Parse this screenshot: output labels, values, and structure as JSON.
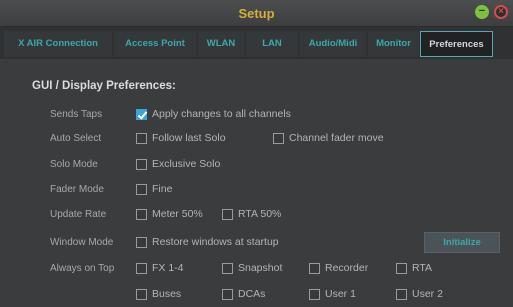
{
  "window": {
    "title": "Setup"
  },
  "tabs": [
    {
      "label": "X AIR Connection"
    },
    {
      "label": "Access Point"
    },
    {
      "label": "WLAN"
    },
    {
      "label": "LAN"
    },
    {
      "label": "Audio/Midi"
    },
    {
      "label": "Monitor"
    },
    {
      "label": "Preferences",
      "active": true
    }
  ],
  "section": {
    "title": "GUI / Display Preferences:"
  },
  "rows": {
    "sends_taps": {
      "label": "Sends Taps"
    },
    "auto_select": {
      "label": "Auto Select"
    },
    "solo_mode": {
      "label": "Solo Mode"
    },
    "fader_mode": {
      "label": "Fader Mode"
    },
    "update_rate": {
      "label": "Update Rate"
    },
    "window_mode": {
      "label": "Window Mode"
    },
    "always_on_top": {
      "label": "Always on Top"
    }
  },
  "options": {
    "apply_all_channels": {
      "label": "Apply changes to all channels",
      "checked": true
    },
    "follow_last_solo": {
      "label": "Follow last Solo",
      "checked": false
    },
    "channel_fader_move": {
      "label": "Channel fader move",
      "checked": false
    },
    "exclusive_solo": {
      "label": "Exclusive Solo",
      "checked": false
    },
    "fine": {
      "label": "Fine",
      "checked": false
    },
    "meter_50": {
      "label": "Meter 50%",
      "checked": false
    },
    "rta_50": {
      "label": "RTA 50%",
      "checked": false
    },
    "restore_windows": {
      "label": "Restore windows at startup",
      "checked": false
    },
    "fx_1_4": {
      "label": "FX 1-4",
      "checked": false
    },
    "snapshot": {
      "label": "Snapshot",
      "checked": false
    },
    "recorder": {
      "label": "Recorder",
      "checked": false
    },
    "rta": {
      "label": "RTA",
      "checked": false
    },
    "buses": {
      "label": "Buses",
      "checked": false
    },
    "dcas": {
      "label": "DCAs",
      "checked": false
    },
    "user_1": {
      "label": "User 1",
      "checked": false
    },
    "user_2": {
      "label": "User 2",
      "checked": false
    }
  },
  "buttons": {
    "initialize": "Initialize"
  },
  "icons": {
    "minimize": "minimize-icon",
    "close": "close-icon"
  },
  "colors": {
    "title": "#d8ac3c",
    "accent": "#3aa9a9",
    "checked": "#3aa4d6"
  }
}
